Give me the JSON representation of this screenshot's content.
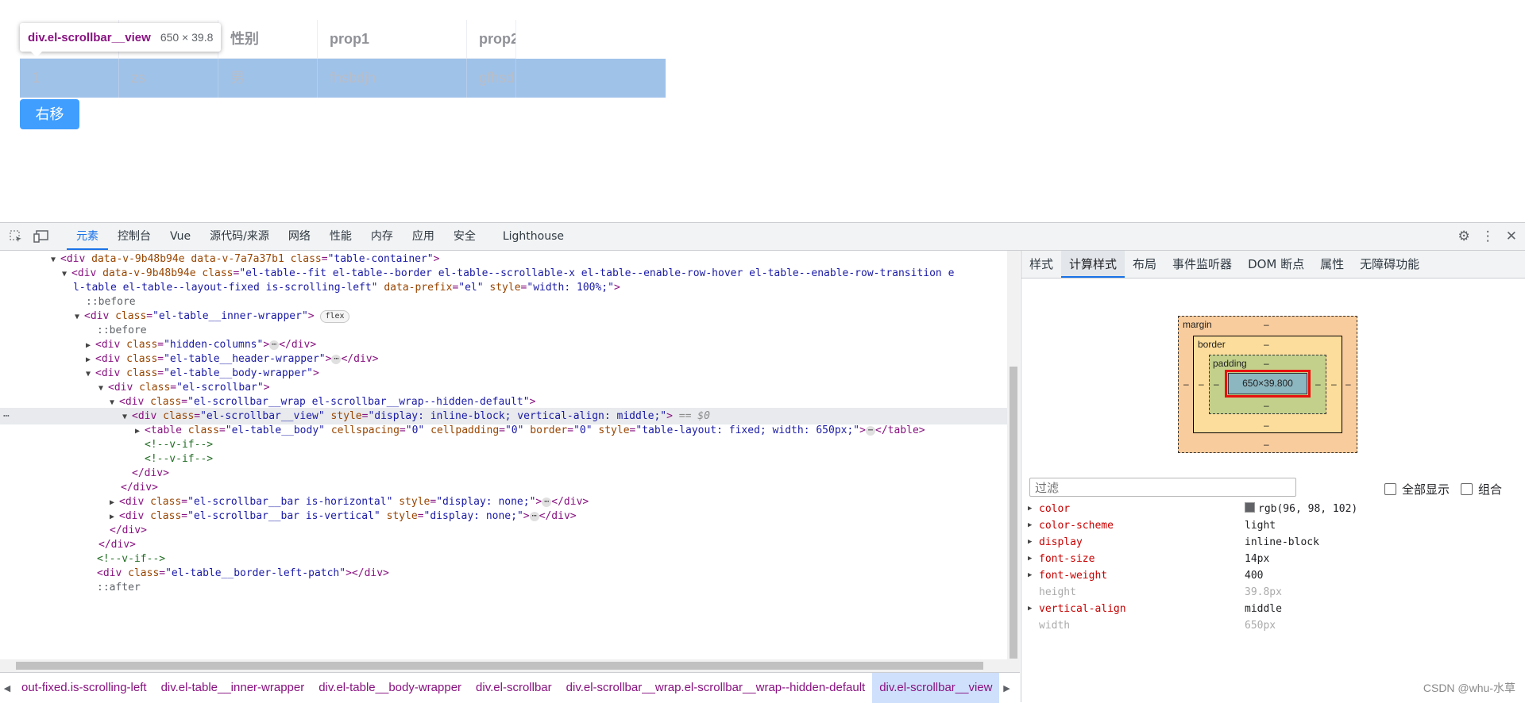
{
  "table": {
    "headers": [
      "",
      "",
      "性别",
      "prop1",
      "prop2"
    ],
    "row": [
      "1",
      "zs",
      "男",
      "fhsbdjh",
      "gfhsd"
    ]
  },
  "move_button": "右移",
  "tooltip": {
    "selector": "div.el-scrollbar__view",
    "size": "650 × 39.8"
  },
  "devtools": {
    "tabs": [
      "元素",
      "控制台",
      "Vue",
      "源代码/来源",
      "网络",
      "性能",
      "内存",
      "应用",
      "安全",
      "Lighthouse"
    ],
    "side_tabs": [
      "样式",
      "计算样式",
      "布局",
      "事件监听器",
      "DOM 断点",
      "属性",
      "无障碍功能"
    ],
    "box_model": {
      "margin": "margin",
      "border": "border",
      "padding": "padding",
      "content": "650×39.800",
      "dash": "–"
    },
    "filter_placeholder": "过滤",
    "show_all": "全部显示",
    "group": "组合",
    "computed": [
      {
        "name": "color",
        "value": "rgb(96, 98, 102)",
        "expandable": true,
        "swatch": "#606266"
      },
      {
        "name": "color-scheme",
        "value": "light",
        "expandable": true
      },
      {
        "name": "display",
        "value": "inline-block",
        "expandable": true
      },
      {
        "name": "font-size",
        "value": "14px",
        "expandable": true
      },
      {
        "name": "font-weight",
        "value": "400",
        "expandable": true
      },
      {
        "name": "height",
        "value": "39.8px",
        "expandable": false,
        "dim": true
      },
      {
        "name": "vertical-align",
        "value": "middle",
        "expandable": true
      },
      {
        "name": "width",
        "value": "650px",
        "expandable": false,
        "dim": true
      }
    ],
    "breadcrumbs": [
      "out-fixed.is-scrolling-left",
      "div.el-table__inner-wrapper",
      "div.el-table__body-wrapper",
      "div.el-scrollbar",
      "div.el-scrollbar__wrap.el-scrollbar__wrap--hidden-default",
      "div.el-scrollbar__view"
    ],
    "watermark": "CSDN @whu-水草"
  }
}
